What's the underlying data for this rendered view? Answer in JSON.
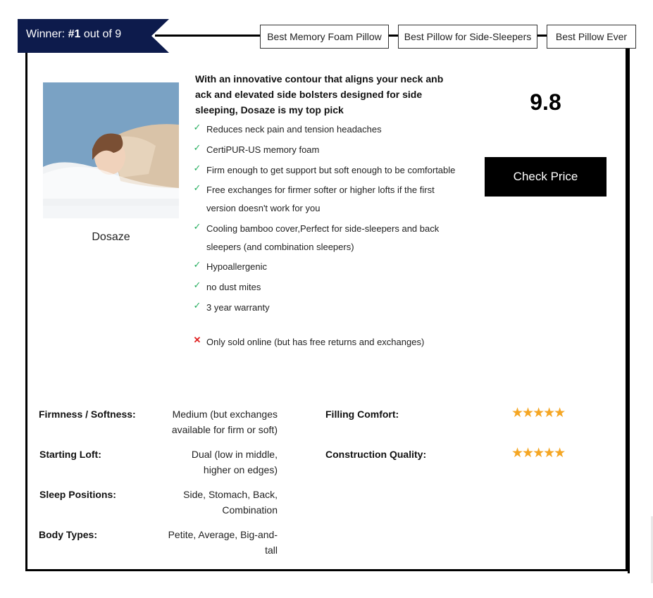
{
  "ribbon": {
    "prefix": "Winner: ",
    "rank": "#1",
    "suffix": " out of 9"
  },
  "tags": [
    "Best Memory Foam Pillow",
    "Best Pillow for Side-Sleepers",
    "Best Pillow Ever"
  ],
  "product": {
    "name": "Dosaze",
    "image_icon": "pillow-photo",
    "description": "With an innovative contour that aligns your neck anb ack and elevated side bolsters designed for side sleeping, Dosaze is my top pick",
    "pros": [
      "Reduces neck pain and tension headaches",
      "CertiPUR-US memory foam",
      "Firm enough to get support but soft enough to be comfortable",
      "Free exchanges for firmer softer or higher lofts if the first version doesn't work for you",
      "Cooling bamboo cover,Perfect for side-sleepers and back sleepers (and combination sleepers)",
      "Hypoallergenic",
      "no dust mites",
      "3 year warranty"
    ],
    "cons": [
      "Only sold online (but has free returns and exchanges)"
    ],
    "score": "9.8",
    "cta_label": "Check Price"
  },
  "specs": {
    "firmness": {
      "label": "Firmness / Softness:",
      "value": "Medium (but exchanges available for firm or soft)"
    },
    "loft": {
      "label": "Starting Loft:",
      "value": "Dual (low in middle, higher on edges)"
    },
    "positions": {
      "label": "Sleep Positions:",
      "value": "Side, Stomach, Back, Combination"
    },
    "body": {
      "label": "Body Types:",
      "value": "Petite, Average, Big-and-tall"
    }
  },
  "ratings": {
    "filling": {
      "label": "Filling Comfort:",
      "stars": "★★★★★",
      "rating": 5
    },
    "construction": {
      "label": "Construction Quality:",
      "stars": "★★★★★",
      "rating": 5
    }
  },
  "colors": {
    "ribbon": "#0d1b4c",
    "check": "#27ae60",
    "cross": "#e02020",
    "star": "#f5a623",
    "button": "#000000"
  }
}
